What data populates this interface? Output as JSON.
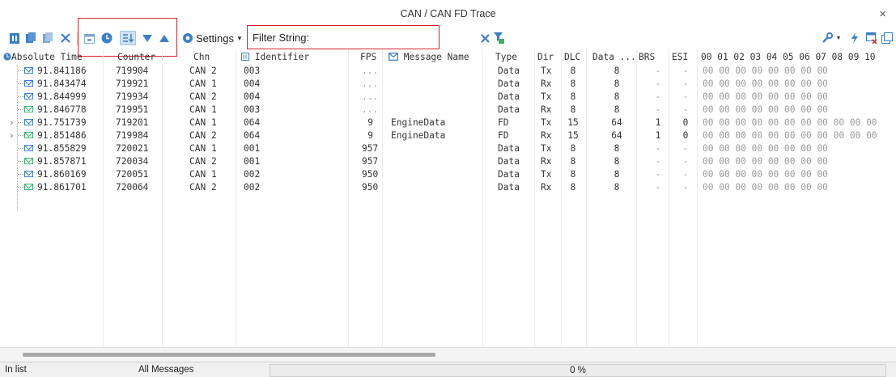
{
  "window": {
    "title": "CAN / CAN FD Trace",
    "close_glyph": "×"
  },
  "toolbar": {
    "settings_label": "Settings",
    "filter_label": "Filter String:",
    "filter_value": ""
  },
  "grid": {
    "columns": {
      "time": "Absolute Time",
      "counter": "Counter",
      "chn": "Chn",
      "identifier": "Identifier",
      "fps": "FPS",
      "message_name": "Message Name",
      "type": "Type",
      "dir": "Dir",
      "dlc": "DLC",
      "data_len": "Data ...",
      "brs": "BRS",
      "esi": "ESI",
      "data_bytes": "00 01 02 03 04 05 06 07 08 09 10"
    },
    "rows": [
      {
        "time": "91.841186",
        "counter": "719904",
        "chn": "CAN 2",
        "id": "003",
        "fps": "...",
        "name": "",
        "type": "Data",
        "dir": "Tx",
        "dlc": "8",
        "len": "8",
        "brs": "-",
        "esi": "-",
        "data": "00 00 00 00 00 00 00 00",
        "expandable": false,
        "icon": "blue"
      },
      {
        "time": "91.843474",
        "counter": "719921",
        "chn": "CAN 1",
        "id": "004",
        "fps": "...",
        "name": "",
        "type": "Data",
        "dir": "Rx",
        "dlc": "8",
        "len": "8",
        "brs": "-",
        "esi": "-",
        "data": "00 00 00 00 00 00 00 00",
        "expandable": false,
        "icon": "blue"
      },
      {
        "time": "91.844999",
        "counter": "719934",
        "chn": "CAN 2",
        "id": "004",
        "fps": "...",
        "name": "",
        "type": "Data",
        "dir": "Tx",
        "dlc": "8",
        "len": "8",
        "brs": "-",
        "esi": "-",
        "data": "00 00 00 00 00 00 00 00",
        "expandable": false,
        "icon": "blue"
      },
      {
        "time": "91.846778",
        "counter": "719951",
        "chn": "CAN 1",
        "id": "003",
        "fps": "...",
        "name": "",
        "type": "Data",
        "dir": "Rx",
        "dlc": "8",
        "len": "8",
        "brs": "-",
        "esi": "-",
        "data": "00 00 00 00 00 00 00 00",
        "expandable": false,
        "icon": "green"
      },
      {
        "time": "91.751739",
        "counter": "719201",
        "chn": "CAN 1",
        "id": "064",
        "fps": "9",
        "name": "EngineData",
        "type": "FD",
        "dir": "Tx",
        "dlc": "15",
        "len": "64",
        "brs": "1",
        "esi": "0",
        "data": "00 00 00 00 00 00 00 00 00 00 00",
        "expandable": true,
        "icon": "blue"
      },
      {
        "time": "91.851486",
        "counter": "719984",
        "chn": "CAN 2",
        "id": "064",
        "fps": "9",
        "name": "EngineData",
        "type": "FD",
        "dir": "Rx",
        "dlc": "15",
        "len": "64",
        "brs": "1",
        "esi": "0",
        "data": "00 00 00 00 00 00 00 00 00 00 00",
        "expandable": true,
        "icon": "green"
      },
      {
        "time": "91.855829",
        "counter": "720021",
        "chn": "CAN 1",
        "id": "001",
        "fps": "957",
        "name": "",
        "type": "Data",
        "dir": "Tx",
        "dlc": "8",
        "len": "8",
        "brs": "-",
        "esi": "-",
        "data": "00 00 00 00 00 00 00 00",
        "expandable": false,
        "icon": "blue"
      },
      {
        "time": "91.857871",
        "counter": "720034",
        "chn": "CAN 2",
        "id": "001",
        "fps": "957",
        "name": "",
        "type": "Data",
        "dir": "Rx",
        "dlc": "8",
        "len": "8",
        "brs": "-",
        "esi": "-",
        "data": "00 00 00 00 00 00 00 00",
        "expandable": false,
        "icon": "green"
      },
      {
        "time": "91.860169",
        "counter": "720051",
        "chn": "CAN 1",
        "id": "002",
        "fps": "950",
        "name": "",
        "type": "Data",
        "dir": "Tx",
        "dlc": "8",
        "len": "8",
        "brs": "-",
        "esi": "-",
        "data": "00 00 00 00 00 00 00 00",
        "expandable": false,
        "icon": "blue"
      },
      {
        "time": "91.861701",
        "counter": "720064",
        "chn": "CAN 2",
        "id": "002",
        "fps": "950",
        "name": "",
        "type": "Data",
        "dir": "Rx",
        "dlc": "8",
        "len": "8",
        "brs": "-",
        "esi": "-",
        "data": "00 00 00 00 00 00 00 00",
        "expandable": false,
        "icon": "green"
      }
    ]
  },
  "statusbar": {
    "left": "In list",
    "middle": "All Messages",
    "progress": "0 %",
    "progress_fraction": 0
  },
  "colors": {
    "accent": "#3c7fc8",
    "highlight_red": "#d9232d",
    "rx_icon": "#3bb06b"
  }
}
